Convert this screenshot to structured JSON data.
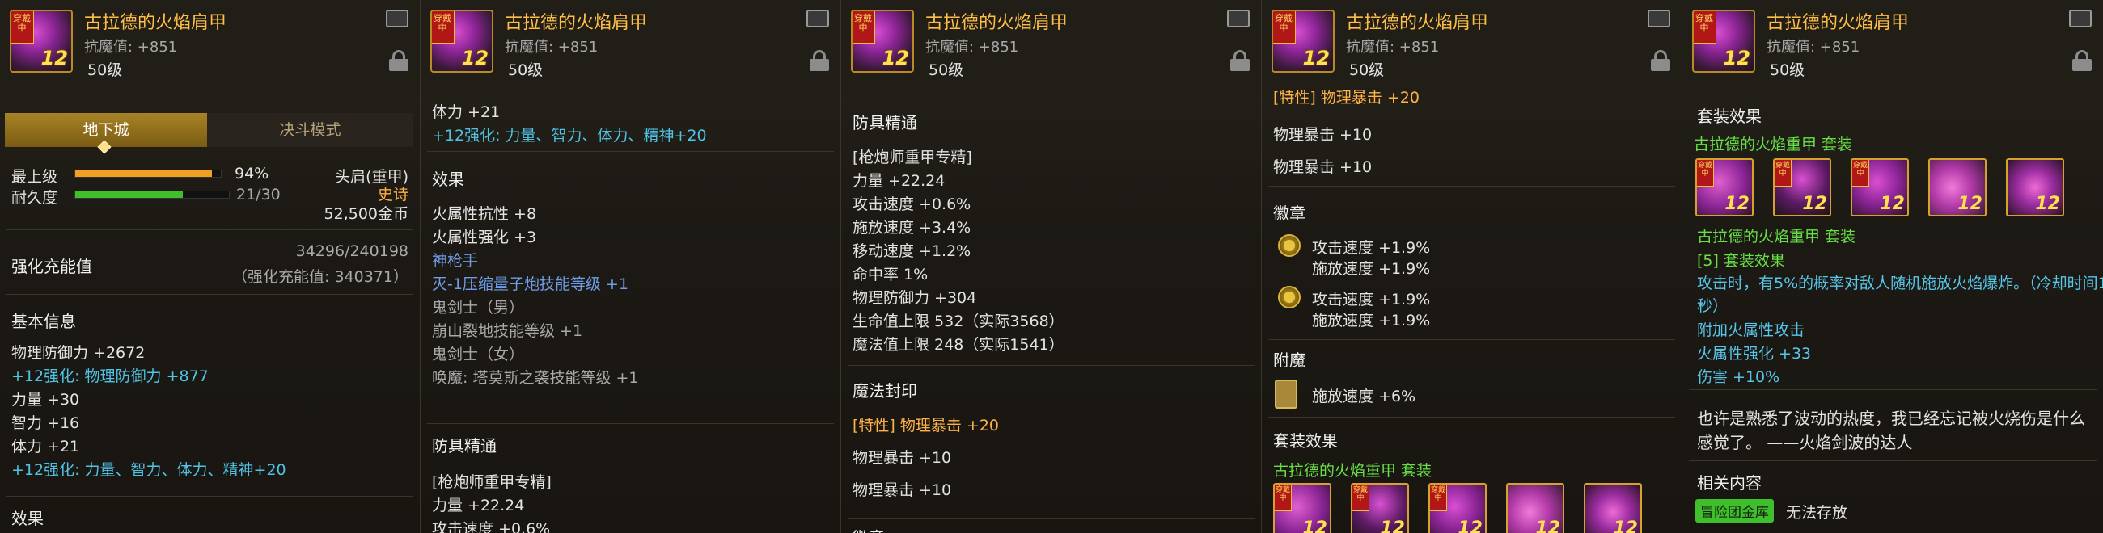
{
  "item": {
    "name": "古拉德的火焰肩甲",
    "magic_resist": "抗魔值: +851",
    "level": "50级",
    "icon_badge": "穿戴中",
    "icon_reinforce": "12"
  },
  "panel1": {
    "tab_dungeon": "地下城",
    "tab_duel": "决斗模式",
    "max_level_label": "最上级",
    "max_level_pct": "94%",
    "max_level_value": 0.94,
    "durability_label": "耐久度",
    "durability_text": "21/30",
    "durability_value": 0.7,
    "slot": "头肩(重甲)",
    "rarity": "史诗",
    "price": "52,500金币",
    "charge_label": "强化充能值",
    "charge_value": "34296/240198",
    "charge_note": "（强化充能值: 340371）",
    "basic_title": "基本信息",
    "stats": [
      {
        "text": "物理防御力 +2672",
        "color": "w"
      },
      {
        "text": "+12强化: 物理防御力 +877",
        "color": "c"
      },
      {
        "text": "力量 +30",
        "color": "w"
      },
      {
        "text": "智力 +16",
        "color": "w"
      },
      {
        "text": "体力 +21",
        "color": "w"
      },
      {
        "text": "+12强化: 力量、智力、体力、精神+20",
        "color": "c"
      }
    ],
    "effect_title": "效果"
  },
  "panel2": {
    "top_lines": [
      {
        "text": "体力 +21",
        "color": "w"
      },
      {
        "text": "+12强化: 力量、智力、体力、精神+20",
        "color": "c"
      }
    ],
    "effect_title": "效果",
    "effects": [
      {
        "text": "火属性抗性 +8",
        "color": "w"
      },
      {
        "text": "火属性强化 +3",
        "color": "w"
      },
      {
        "text": "神枪手",
        "color": "b"
      },
      {
        "text": "灭-1压缩量子炮技能等级 +1",
        "color": "b"
      },
      {
        "text": "鬼剑士（男）",
        "color": "g"
      },
      {
        "text": "崩山裂地技能等级 +1",
        "color": "g"
      },
      {
        "text": "鬼剑士（女）",
        "color": "g"
      },
      {
        "text": "唤魔: 塔莫斯之袭技能等级 +1",
        "color": "g"
      }
    ],
    "mastery_title": "防具精通",
    "mastery_lines": [
      {
        "text": "[枪炮师重甲专精]",
        "color": "w"
      },
      {
        "text": "力量 +22.24",
        "color": "w"
      },
      {
        "text": "攻击速度 +0.6%",
        "color": "w"
      }
    ]
  },
  "panel3": {
    "mastery_title": "防具精通",
    "mastery_lines": [
      {
        "text": "[枪炮师重甲专精]",
        "color": "w"
      },
      {
        "text": "力量 +22.24",
        "color": "w"
      },
      {
        "text": "攻击速度 +0.6%",
        "color": "w"
      },
      {
        "text": "施放速度 +3.4%",
        "color": "w"
      },
      {
        "text": "移动速度 +1.2%",
        "color": "w"
      },
      {
        "text": "命中率 1%",
        "color": "w"
      },
      {
        "text": "物理防御力 +304",
        "color": "w"
      },
      {
        "text": "生命值上限 532（实际3568）",
        "color": "w"
      },
      {
        "text": "魔法值上限 248（实际1541）",
        "color": "w"
      }
    ],
    "seal_title": "魔法封印",
    "seal_lines": [
      {
        "text": "[特性] 物理暴击 +20",
        "color": "o"
      },
      {
        "text": "物理暴击 +10",
        "color": "w"
      },
      {
        "text": "物理暴击 +10",
        "color": "w"
      }
    ],
    "emblem_title": "徽章"
  },
  "panel4": {
    "top_partial": "[特性] 物理暴击 +20",
    "top_lines": [
      {
        "text": "物理暴击 +10",
        "color": "w"
      },
      {
        "text": "物理暴击 +10",
        "color": "w"
      }
    ],
    "emblem_title": "徽章",
    "emblems": [
      {
        "line1": "攻击速度 +1.9%",
        "line2": "施放速度 +1.9%"
      },
      {
        "line1": "攻击速度 +1.9%",
        "line2": "施放速度 +1.9%"
      }
    ],
    "enchant_title": "附魔",
    "enchant_line": "施放速度 +6%",
    "set_title": "套装效果",
    "set_name": "古拉德的火焰重甲 套装"
  },
  "panel5": {
    "set_title": "套装效果",
    "set_name": "古拉德的火焰重甲 套装",
    "set_name2": "古拉德的火焰重甲 套装",
    "set_effect_header": "[5] 套装效果",
    "set_desc_lines": [
      "攻击时，有5%的概率对敌人随机施放火焰爆炸。（冷却时间1",
      "秒）"
    ],
    "set_bonus": [
      {
        "text": "附加火属性攻击",
        "color": "cy"
      },
      {
        "text": "火属性强化 +33",
        "color": "cy"
      },
      {
        "text": "伤害 +10%",
        "color": "cy"
      }
    ],
    "flavor_lines": [
      "也许是熟悉了波动的热度，我已经忘记被火烧伤是什么",
      "感觉了。 ——火焰剑波的达人"
    ],
    "related_title": "相关内容",
    "related_tag": "冒险团金库",
    "related_text": "无法存放"
  },
  "colors": {
    "gold": "#ffbf45",
    "cyan": "#4fc3e6",
    "blue": "#6f9de8",
    "green": "#66e046",
    "orange": "#ffb347",
    "exp_bar": "#f0a020",
    "dur_bar": "#3fbf2c"
  }
}
